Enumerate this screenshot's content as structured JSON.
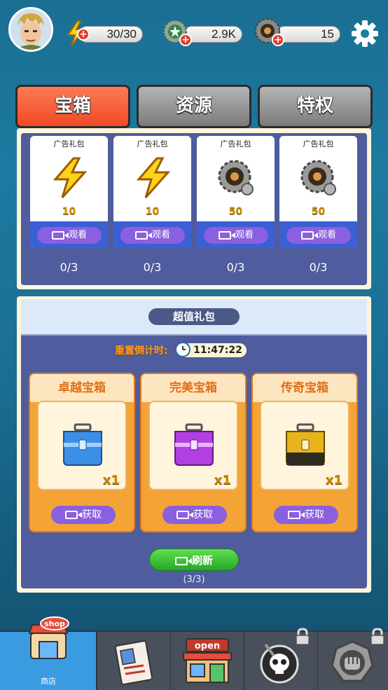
{
  "top_bar": {
    "energy": "30/30",
    "coins": "2.9K",
    "gears": "15"
  },
  "tabs": [
    {
      "label": "宝箱",
      "active": true
    },
    {
      "label": "资源",
      "active": false
    },
    {
      "label": "特权",
      "active": false
    }
  ],
  "ad_packs": [
    {
      "title": "广告礼包",
      "icon": "lightning-icon",
      "amount": "10",
      "watch_label": "观看",
      "progress": "0/3"
    },
    {
      "title": "广告礼包",
      "icon": "lightning-icon",
      "amount": "10",
      "watch_label": "观看",
      "progress": "0/3"
    },
    {
      "title": "广告礼包",
      "icon": "gear-token-icon",
      "amount": "50",
      "watch_label": "观看",
      "progress": "0/3"
    },
    {
      "title": "广告礼包",
      "icon": "gear-token-icon",
      "amount": "50",
      "watch_label": "观看",
      "progress": "0/3"
    }
  ],
  "value_pack": {
    "banner": "超值礼包",
    "timer_label": "重置倒计时:",
    "timer": "11:47:22",
    "boxes": [
      {
        "name": "卓越宝箱",
        "color": "#3b8fe6",
        "qty": "x1",
        "get_label": "获取"
      },
      {
        "name": "完美宝箱",
        "color": "#b23fe0",
        "qty": "x1",
        "get_label": "获取"
      },
      {
        "name": "传奇宝箱",
        "color": "#e8b41c",
        "qty": "x1",
        "get_label": "获取"
      }
    ],
    "refresh_label": "刷新",
    "refresh_count": "(3/3)"
  },
  "nav": {
    "shop_label": "商店",
    "shop_sign": "shop",
    "store_sign": "open"
  },
  "colors": {
    "active_tab": "#ef4a25",
    "panel": "#4f5c9d",
    "nav_active": "#3a9be0"
  }
}
